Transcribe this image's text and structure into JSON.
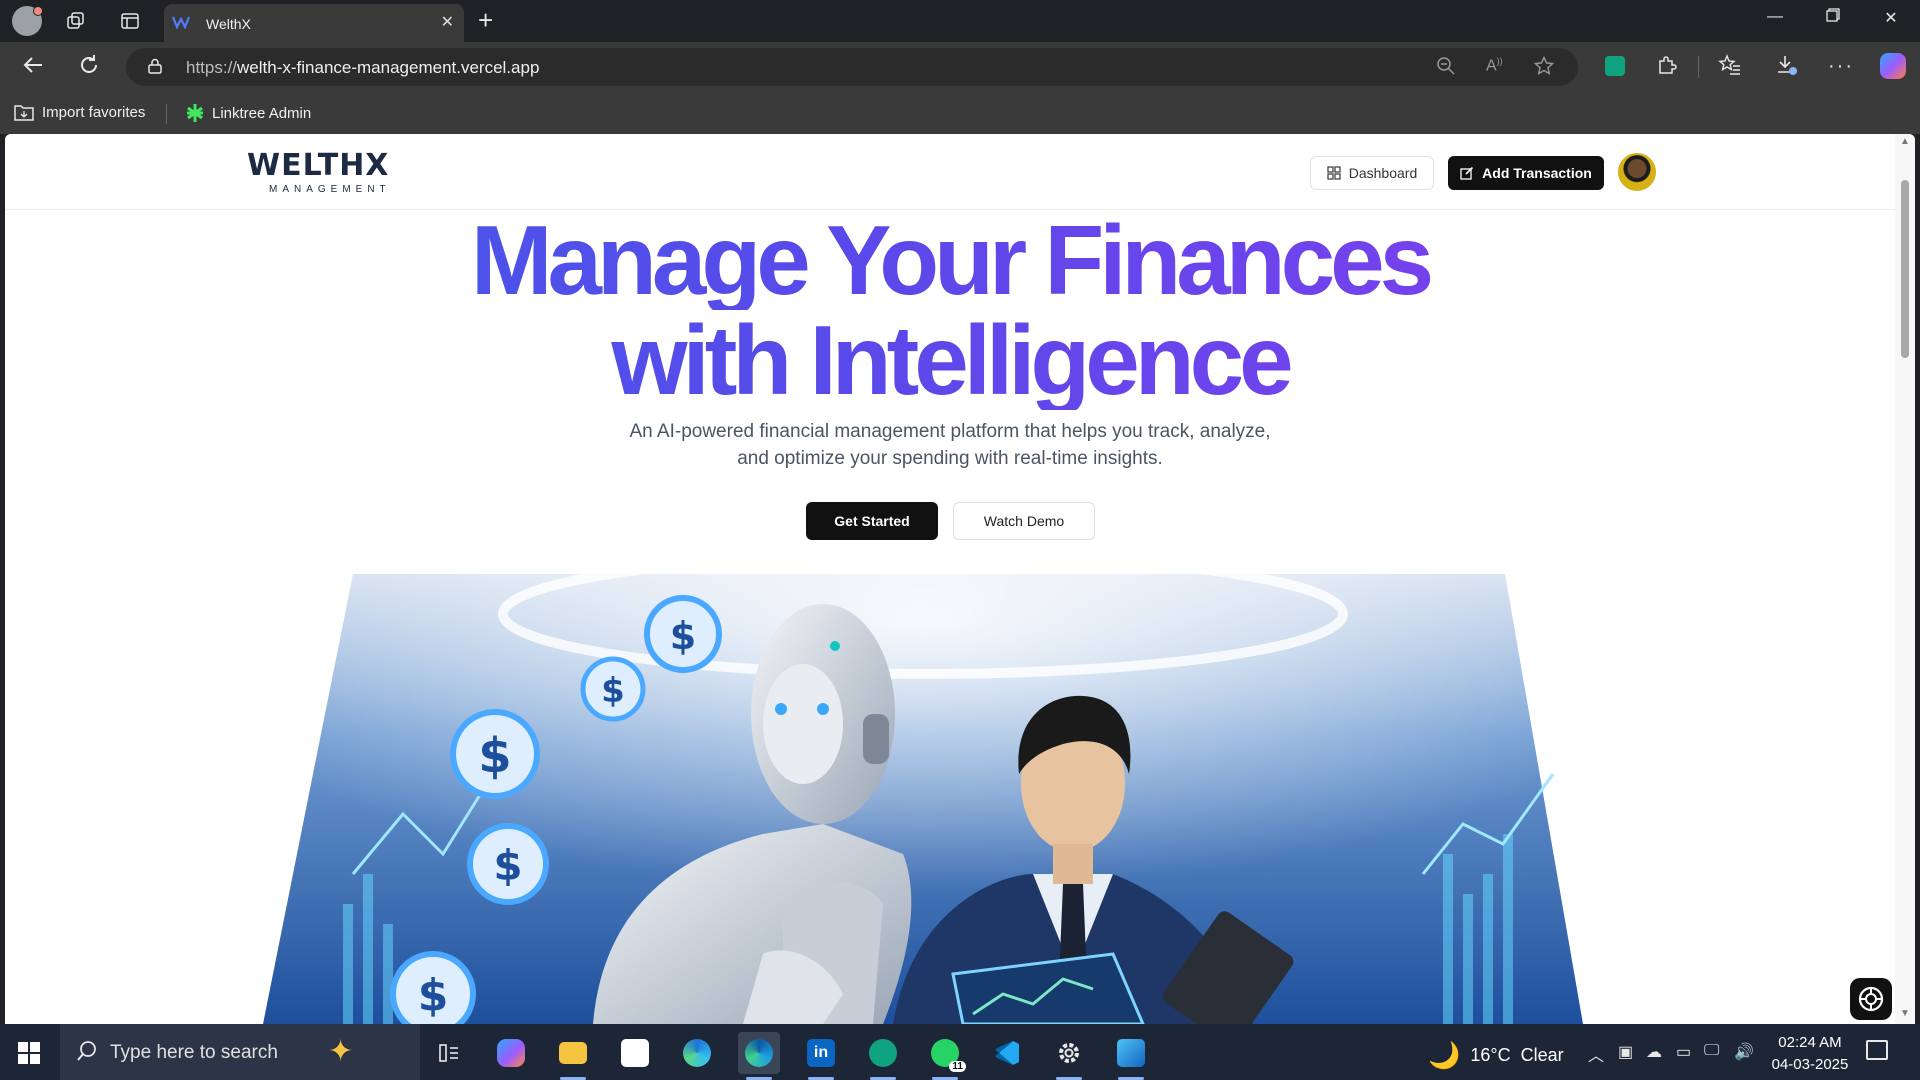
{
  "browser": {
    "tab_title": "WelthX",
    "url_prefix": "https://",
    "url_host": "welth-x-finance-management.vercel.app",
    "bookmarks": [
      {
        "label": "Import favorites"
      },
      {
        "label": "Linktree Admin"
      }
    ]
  },
  "header": {
    "logo_word": "WELTHX",
    "logo_sub": "MANAGEMENT",
    "dashboard_label": "Dashboard",
    "add_transaction_label": "Add Transaction"
  },
  "hero": {
    "title_line1": "Manage Your Finances",
    "title_line2": "with Intelligence",
    "subtitle": "An AI-powered financial management platform that helps you track, analyze, and optimize your spending with real-time insights.",
    "get_started_label": "Get Started",
    "watch_demo_label": "Watch Demo"
  },
  "taskbar": {
    "search_placeholder": "Type here to search",
    "whatsapp_badge": "11",
    "weather_temp": "16°C",
    "weather_text": "Clear",
    "time": "02:24 AM",
    "date": "04-03-2025"
  },
  "colors": {
    "title_gradient_start": "#3d5de8",
    "title_gradient_end": "#8a3cf0",
    "primary_button": "#111111",
    "taskbar_bg": "#1c2637"
  }
}
